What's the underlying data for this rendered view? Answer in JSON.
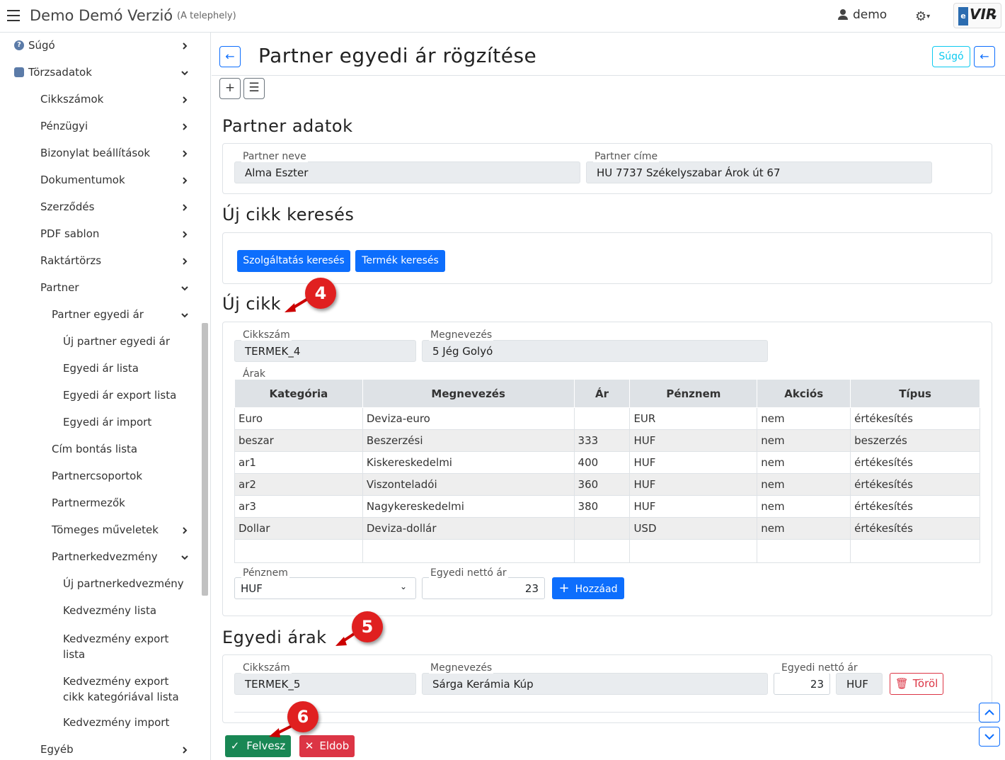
{
  "header": {
    "title": "Demo Demó Verzió",
    "subtitle": "(A telephely)",
    "user": "demo",
    "logo_text": "VIR",
    "logo_prefix": "e"
  },
  "sidebar": {
    "items": [
      {
        "label": "Súgó",
        "icon": "question-circle-icon",
        "chevron": "right"
      },
      {
        "label": "Törzsadatok",
        "icon": "database-icon",
        "chevron": "down"
      },
      {
        "label": "Cikkszámok",
        "chevron": "right"
      },
      {
        "label": "Pénzügyi",
        "chevron": "right"
      },
      {
        "label": "Bizonylat beállítások",
        "chevron": "right"
      },
      {
        "label": "Dokumentumok",
        "chevron": "right"
      },
      {
        "label": "Szerződés",
        "chevron": "right"
      },
      {
        "label": "PDF sablon",
        "chevron": "right"
      },
      {
        "label": "Raktártörzs",
        "chevron": "right"
      },
      {
        "label": "Partner",
        "chevron": "down"
      },
      {
        "label": "Partner egyedi ár",
        "chevron": "down"
      },
      {
        "label": "Új partner egyedi ár"
      },
      {
        "label": "Egyedi ár lista"
      },
      {
        "label": "Egyedi ár export lista"
      },
      {
        "label": "Egyedi ár import"
      },
      {
        "label": "Cím bontás lista"
      },
      {
        "label": "Partnercsoportok"
      },
      {
        "label": "Partnermezők"
      },
      {
        "label": "Tömeges műveletek",
        "chevron": "right"
      },
      {
        "label": "Partnerkedvezmény",
        "chevron": "down"
      },
      {
        "label": "Új partnerkedvezmény"
      },
      {
        "label": "Kedvezmény lista"
      },
      {
        "label": "Kedvezmény export lista"
      },
      {
        "label": "Kedvezmény export cikk kategóriával lista"
      },
      {
        "label": "Kedvezmény import"
      },
      {
        "label": "Egyéb",
        "chevron": "right"
      }
    ]
  },
  "page": {
    "title": "Partner egyedi ár rögzítése",
    "help_label": "Súgó"
  },
  "partner": {
    "section_title": "Partner adatok",
    "name_label": "Partner neve",
    "name_value": "Alma Eszter",
    "address_label": "Partner címe",
    "address_value": "HU 7737 Székelyszabar Árok út 67"
  },
  "search": {
    "section_title": "Új cikk keresés",
    "service_btn": "Szolgáltatás keresés",
    "product_btn": "Termék keresés"
  },
  "new_item": {
    "section_title": "Új cikk",
    "sku_label": "Cikkszám",
    "sku_value": "TERMEK_4",
    "name_label": "Megnevezés",
    "name_value": "5 Jég Golyó",
    "prices_label": "Árak",
    "columns": [
      "Kategória",
      "Megnevezés",
      "Ár",
      "Pénznem",
      "Akciós",
      "Típus"
    ],
    "rows": [
      [
        "Euro",
        "Deviza-euro",
        "",
        "EUR",
        "nem",
        "értékesítés"
      ],
      [
        "beszar",
        "Beszerzési",
        "333",
        "HUF",
        "nem",
        "beszerzés"
      ],
      [
        "ar1",
        "Kiskereskedelmi",
        "400",
        "HUF",
        "nem",
        "értékesítés"
      ],
      [
        "ar2",
        "Viszonteladói",
        "360",
        "HUF",
        "nem",
        "értékesítés"
      ],
      [
        "ar3",
        "Nagykereskedelmi",
        "380",
        "HUF",
        "nem",
        "értékesítés"
      ],
      [
        "Dollar",
        "Deviza-dollár",
        "",
        "USD",
        "nem",
        "értékesítés"
      ],
      [
        "",
        "",
        "",
        "",
        "",
        ""
      ]
    ],
    "currency_label": "Pénznem",
    "currency_value": "HUF",
    "net_label": "Egyedi nettó ár",
    "net_value": "23",
    "add_btn": "Hozzáad"
  },
  "custom_prices": {
    "section_title": "Egyedi árak",
    "sku_label": "Cikkszám",
    "sku_value": "TERMEK_5",
    "name_label": "Megnevezés",
    "name_value": "Sárga Kerámia Kúp",
    "net_label": "Egyedi nettó ár",
    "net_value": "23",
    "currency": "HUF",
    "delete_btn": "Töröl"
  },
  "footer": {
    "save_btn": "Felvesz",
    "discard_btn": "Eldob"
  },
  "annotations": [
    "4",
    "5",
    "6"
  ],
  "colors": {
    "primary": "#0d6efd",
    "success": "#198754",
    "danger": "#dc3545",
    "info": "#0dcaf0",
    "badge": "#e02020"
  }
}
